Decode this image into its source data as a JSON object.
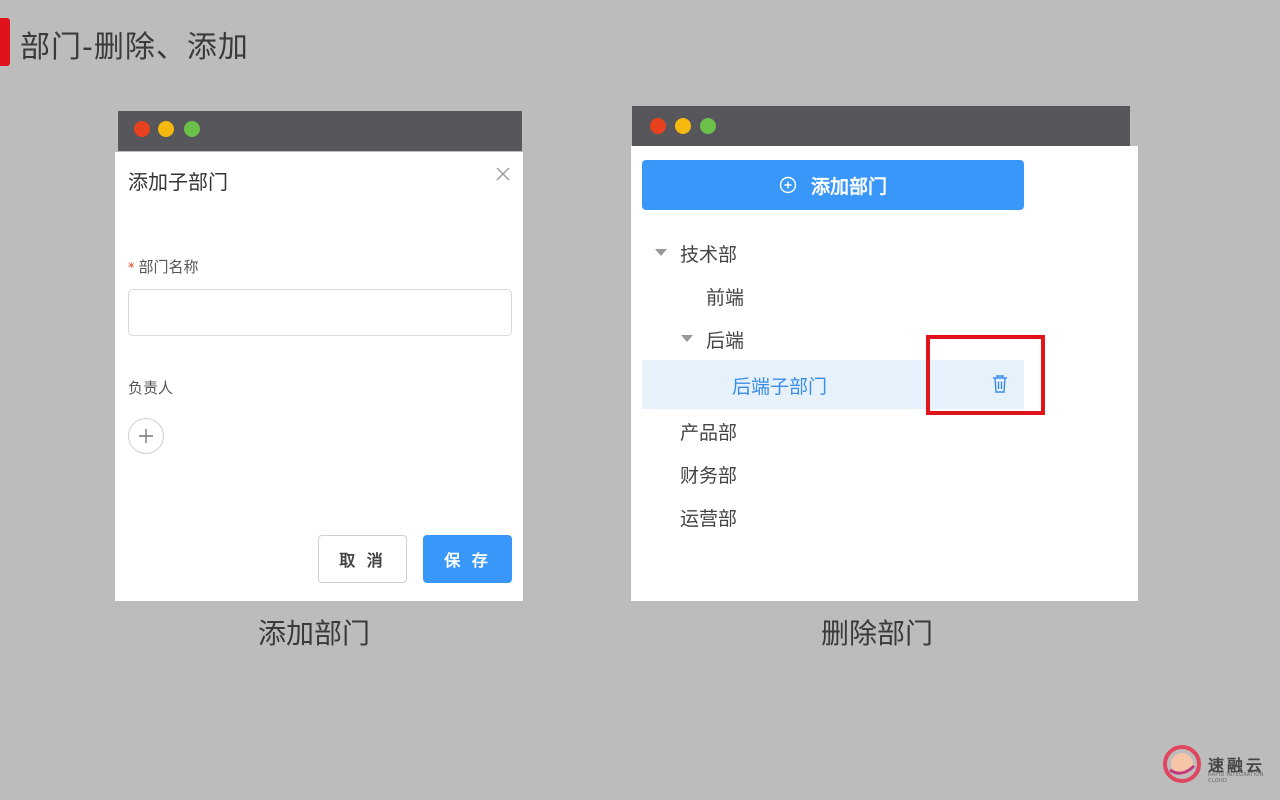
{
  "slide": {
    "title": "部门-删除、添加"
  },
  "left_panel": {
    "dialog_title": "添加子部门",
    "dept_name_required": "*",
    "dept_name_label": "部门名称",
    "dept_name_value": "",
    "owner_label": "负责人",
    "cancel_label": "取 消",
    "save_label": "保 存",
    "caption": "添加部门"
  },
  "right_panel": {
    "add_button_label": "添加部门",
    "tree": [
      {
        "label": "技术部",
        "level": 0,
        "expanded": true
      },
      {
        "label": "前端",
        "level": 1
      },
      {
        "label": "后端",
        "level": 1,
        "expanded": true
      },
      {
        "label": "后端子部门",
        "level": 2,
        "selected": true
      },
      {
        "label": "产品部",
        "level": 0
      },
      {
        "label": "财务部",
        "level": 0
      },
      {
        "label": "运营部",
        "level": 0
      }
    ],
    "caption": "删除部门"
  },
  "branding": {
    "logo_text": "速融云",
    "logo_sub": "RAPID INTEGRATION CLOUD"
  },
  "colors": {
    "accent": "#3a97fa",
    "highlight": "#e0141b",
    "title_marker": "#e0121b"
  }
}
